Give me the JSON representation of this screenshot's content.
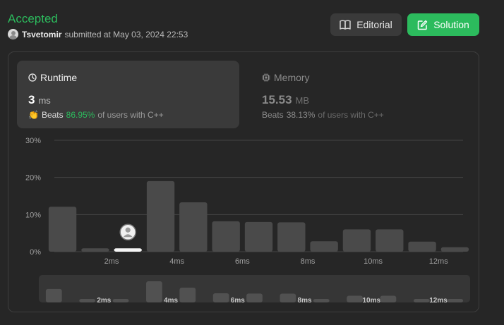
{
  "submission": {
    "status": "Accepted",
    "username": "Tsvetomir",
    "submitted_text": "submitted at May 03, 2024 22:53"
  },
  "buttons": {
    "editorial": "Editorial",
    "solution": "Solution"
  },
  "runtime": {
    "title": "Runtime",
    "value": "3",
    "unit": "ms",
    "beats_label": "Beats",
    "beats_pct": "86.95%",
    "beats_tail": "of users with C++"
  },
  "memory": {
    "title": "Memory",
    "value": "15.53",
    "unit": "MB",
    "beats_label": "Beats",
    "beats_pct": "38.13%",
    "beats_tail": "of users with C++"
  },
  "colors": {
    "accent": "#2cbb5d",
    "bar": "#4a4a4a",
    "highlight_bar": "#f5f5f5"
  },
  "chart_data": {
    "type": "bar",
    "x": [
      1,
      1.5,
      2,
      2.5,
      3,
      3.5,
      4,
      4.5,
      5,
      5.5,
      6,
      6.5,
      7,
      7.5,
      8,
      8.5,
      9,
      9.5,
      10,
      10.5,
      11,
      11.5,
      12,
      12.5,
      13
    ],
    "values": [
      12.1,
      0,
      0.9,
      0,
      0.9,
      0,
      19,
      0,
      13.3,
      0,
      8.2,
      0,
      8,
      0,
      7.9,
      0,
      2.8,
      0,
      6,
      0,
      6,
      0,
      2.7,
      0,
      1.2
    ],
    "yticks": [
      "0%",
      "10%",
      "20%",
      "30%"
    ],
    "ylim": [
      0,
      30
    ],
    "xticks": [
      "2ms",
      "4ms",
      "6ms",
      "8ms",
      "10ms",
      "12ms"
    ],
    "xtick_values": [
      2.5,
      4.5,
      6.5,
      8.5,
      10.5,
      12.5
    ],
    "highlight_x": 3,
    "grid": true,
    "overview": {
      "xticks": [
        "2ms",
        "4ms",
        "6ms",
        "8ms",
        "10ms",
        "12ms"
      ]
    }
  }
}
